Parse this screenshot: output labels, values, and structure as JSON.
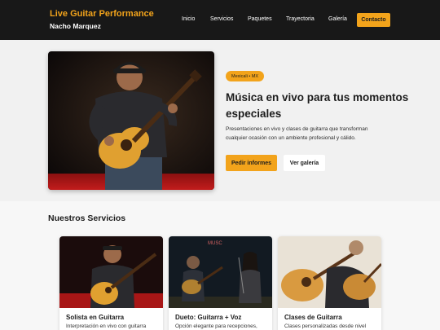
{
  "header": {
    "brand_title": "Live Guitar Performance",
    "brand_subtitle": "Nacho Marquez",
    "nav": [
      "Inicio",
      "Servicios",
      "Paquetes",
      "Trayectoria",
      "Galería"
    ],
    "cta": "Contacto"
  },
  "hero": {
    "badge": "Mexicali • MX",
    "title": "Música en vivo para tus momentos especiales",
    "text": "Presentaciones en vivo y clases de guitarra que transforman cualquier ocasión con un ambiente profesional y cálido.",
    "primary_button": "Pedir informes",
    "secondary_button": "Ver galería"
  },
  "services": {
    "title": "Nuestros Servicios",
    "cards": [
      {
        "title": "Solista en Guitarra",
        "text": "Interpretación en vivo con guitarra"
      },
      {
        "title": "Dueto: Guitarra + Voz",
        "text": "Opción elegante para recepciones,"
      },
      {
        "title": "Clases de Guitarra",
        "text": "Clases personalizadas desde nivel"
      }
    ]
  },
  "colors": {
    "accent": "#f2a31b",
    "header_bg": "#181818"
  }
}
